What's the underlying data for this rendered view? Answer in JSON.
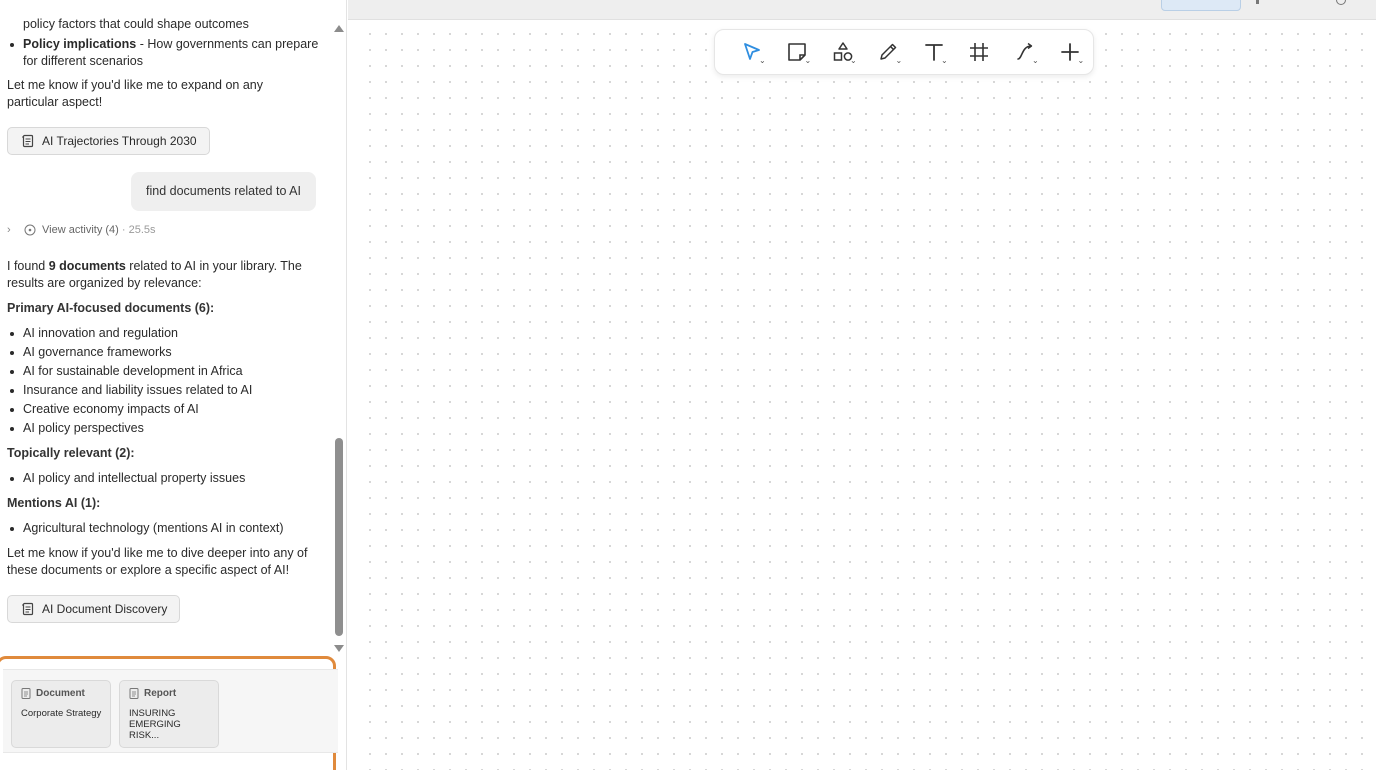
{
  "chat": {
    "prev_bullet_tail": "policy factors that could shape outcomes",
    "prev_bullet_bold": "Policy implications",
    "prev_bullet_rest": " - How governments can prepare for different scenarios",
    "prev_closing": "Let me know if you'd like me to expand on any particular aspect!",
    "prev_artifact": "AI Trajectories Through 2030",
    "user_message": "find documents related to AI",
    "activity_label": "View activity (4)",
    "activity_duration": "· 25.5s",
    "intro_prefix": "I found ",
    "intro_bold": "9 documents",
    "intro_suffix": " related to AI in your library. The results are organized by relevance:",
    "sections": [
      {
        "heading": "Primary AI-focused documents (6):",
        "items": [
          "AI innovation and regulation",
          "AI governance frameworks",
          "AI for sustainable development in Africa",
          "Insurance and liability issues related to AI",
          "Creative economy impacts of AI",
          "AI policy perspectives"
        ]
      },
      {
        "heading": "Topically relevant (2):",
        "items": [
          "AI policy and intellectual property issues"
        ]
      },
      {
        "heading": "Mentions AI (1):",
        "items": [
          "Agricultural technology (mentions AI in context)"
        ]
      }
    ],
    "closing": "Let me know if you'd like me to dive deeper into any of these documents or explore a specific aspect of AI!",
    "artifact": "AI Document Discovery"
  },
  "composer": {
    "accent": "#e08a3c",
    "context_cards": [
      {
        "kind": "Document",
        "title": "Corporate Strategy"
      },
      {
        "kind": "Report",
        "title": "INSURING EMERGING RISK..."
      }
    ]
  },
  "toolbar": {
    "accent": "#2f8ee0",
    "tools": [
      "select-tool",
      "note-tool",
      "shapes-tool",
      "pen-tool",
      "text-tool",
      "frame-tool",
      "connector-tool",
      "add-tool"
    ]
  }
}
